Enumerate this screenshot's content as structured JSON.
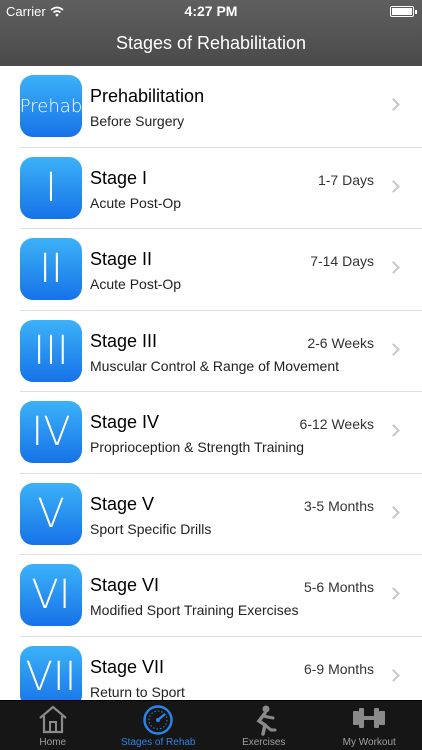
{
  "status_bar": {
    "carrier": "Carrier",
    "time": "4:27 PM",
    "battery_level": 1.0
  },
  "nav": {
    "title": "Stages of Rehabilitation"
  },
  "stages": [
    {
      "icon_text": "Prehab",
      "title": "Prehabilitation",
      "subtitle": "Before Surgery",
      "duration": ""
    },
    {
      "icon_text": "I",
      "title": "Stage I",
      "subtitle": "Acute Post-Op",
      "duration": "1-7 Days"
    },
    {
      "icon_text": "II",
      "title": "Stage II",
      "subtitle": "Acute Post-Op",
      "duration": "7-14 Days"
    },
    {
      "icon_text": "III",
      "title": "Stage III",
      "subtitle": "Muscular Control & Range of Movement",
      "duration": "2-6 Weeks"
    },
    {
      "icon_text": "IV",
      "title": "Stage IV",
      "subtitle": "Proprioception & Strength Training",
      "duration": "6-12 Weeks"
    },
    {
      "icon_text": "V",
      "title": "Stage V",
      "subtitle": "Sport Specific Drills",
      "duration": "3-5 Months"
    },
    {
      "icon_text": "VI",
      "title": "Stage VI",
      "subtitle": "Modified Sport Training Exercises",
      "duration": "5-6 Months"
    },
    {
      "icon_text": "VII",
      "title": "Stage VII",
      "subtitle": "Return to Sport",
      "duration": "6-9 Months"
    }
  ],
  "tabs": [
    {
      "label": "Home",
      "icon": "home-icon",
      "active": false
    },
    {
      "label": "Stages of Rehab",
      "icon": "gauge-icon",
      "active": true
    },
    {
      "label": "Exercises",
      "icon": "squat-figure-icon",
      "active": false
    },
    {
      "label": "My Workout",
      "icon": "dumbbell-icon",
      "active": false
    }
  ],
  "colors": {
    "accent": "#2a86ea",
    "tile_top": "#3cb2f8",
    "tile_bottom": "#1672e8",
    "header": "#555555",
    "tabbar": "#161616"
  }
}
